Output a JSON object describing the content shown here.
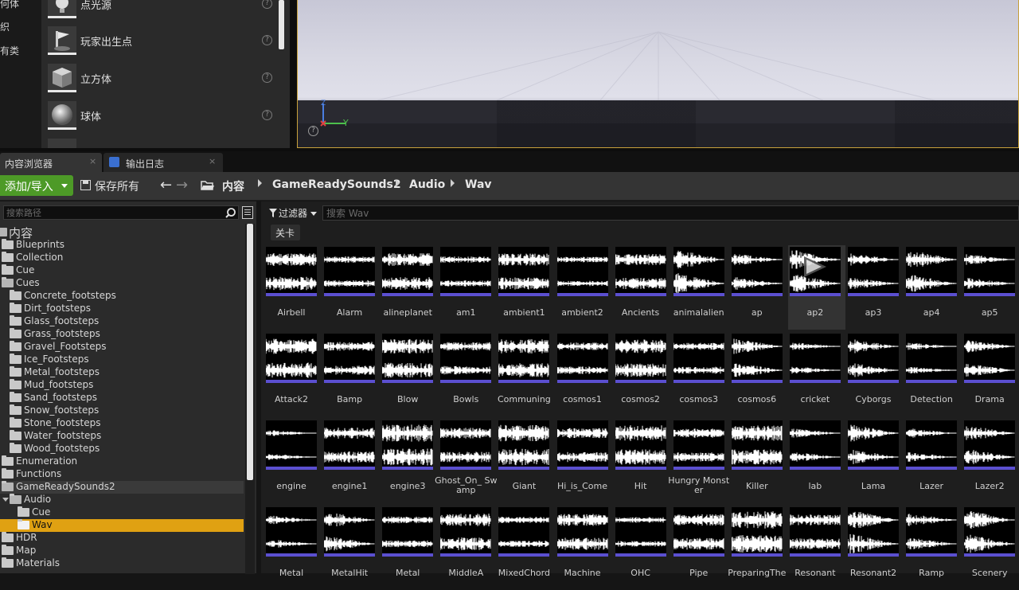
{
  "place_categories": [
    "何体",
    "织",
    "有类"
  ],
  "place_items": [
    {
      "label": "点光源",
      "icon": "point-light-icon"
    },
    {
      "label": "玩家出生点",
      "icon": "player-start-icon"
    },
    {
      "label": "立方体",
      "icon": "cube-icon"
    },
    {
      "label": "球体",
      "icon": "sphere-icon"
    }
  ],
  "viewport": {
    "axis_y": "Y",
    "axis_z": "Z",
    "help": "?"
  },
  "tabs": [
    {
      "label": "内容浏览器",
      "close": "×"
    },
    {
      "label": "输出日志",
      "close": "×"
    }
  ],
  "toolbar": {
    "add_import": "添加/导入",
    "save_all": "保存所有",
    "breadcrumbs": [
      "内容",
      "GameReadySounds2",
      "Audio",
      "Wav"
    ]
  },
  "tree": {
    "search_placeholder": "搜索路径",
    "root": "内容",
    "items": [
      {
        "label": "Blueprints",
        "level": 1
      },
      {
        "label": "Collection",
        "level": 1
      },
      {
        "label": "Cue",
        "level": 1
      },
      {
        "label": "Cues",
        "level": 1,
        "open": true
      },
      {
        "label": "Concrete_footsteps",
        "level": 2
      },
      {
        "label": "Dirt_footsteps",
        "level": 2
      },
      {
        "label": "Glass_footsteps",
        "level": 2
      },
      {
        "label": "Grass_footsteps",
        "level": 2
      },
      {
        "label": "Gravel_Footsteps",
        "level": 2
      },
      {
        "label": "Ice_Footsteps",
        "level": 2
      },
      {
        "label": "Metal_footsteps",
        "level": 2
      },
      {
        "label": "Mud_footsteps",
        "level": 2
      },
      {
        "label": "Sand_footsteps",
        "level": 2
      },
      {
        "label": "Snow_footsteps",
        "level": 2
      },
      {
        "label": "Stone_footsteps",
        "level": 2
      },
      {
        "label": "Water_footsteps",
        "level": 2
      },
      {
        "label": "Wood_footsteps",
        "level": 2
      },
      {
        "label": "Enumeration",
        "level": 1
      },
      {
        "label": "Functions",
        "level": 1
      },
      {
        "label": "GameReadySounds2",
        "level": 1,
        "open": true,
        "highlight": true
      },
      {
        "label": "Audio",
        "level": 2,
        "open": true,
        "arrow": true
      },
      {
        "label": "Cue",
        "level": 3
      },
      {
        "label": "Wav",
        "level": 3,
        "selected": true,
        "open": true
      },
      {
        "label": "HDR",
        "level": 1
      },
      {
        "label": "Map",
        "level": 1
      },
      {
        "label": "Materials",
        "level": 1
      }
    ]
  },
  "assets": {
    "filter_label": "过滤器",
    "search_placeholder": "搜索 Wav",
    "level_chip": "关卡",
    "accent_color": "#5b4fd0",
    "items": [
      "Airbell",
      "Alarm",
      "alineplanet",
      "am1",
      "ambient1",
      "ambient2",
      "Ancients",
      "animalalien",
      "ap",
      "ap2",
      "ap3",
      "ap4",
      "ap5",
      "Attack2",
      "Bamp",
      "Blow",
      "Bowls",
      "Communing",
      "cosmos1",
      "cosmos2",
      "cosmos3",
      "cosmos6",
      "cricket",
      "Cyborgs",
      "Detection",
      "Drama",
      "engine",
      "engine1",
      "engine3",
      "Ghost_On_ Swamp",
      "Giant",
      "Hi_is_Come",
      "Hit",
      "Hungry Monster",
      "Killer",
      "lab",
      "Lama",
      "Lazer",
      "Lazer2",
      "Metal",
      "MetalHit",
      "Metal",
      "MiddleA",
      "MixedChord",
      "Machine",
      "OHC",
      "Pipe",
      "PreparingThe",
      "Resonant",
      "Resonant2",
      "Ramp",
      "Scenery"
    ]
  }
}
